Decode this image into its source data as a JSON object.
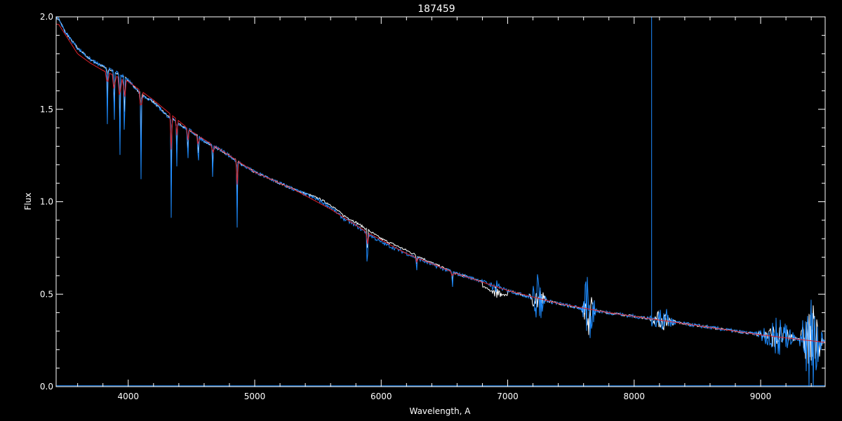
{
  "chart_data": {
    "type": "line",
    "title": "187459",
    "xlabel": "Wavelength, A",
    "ylabel": "Flux",
    "xlim": [
      3430,
      9510
    ],
    "ylim": [
      0.0,
      2.0
    ],
    "x_ticks": [
      4000,
      5000,
      6000,
      7000,
      8000,
      9000
    ],
    "x_tick_labels": [
      "4000",
      "5000",
      "6000",
      "7000",
      "8000",
      "9000"
    ],
    "y_ticks": [
      0.0,
      0.5,
      1.0,
      1.5,
      2.0
    ],
    "y_tick_labels": [
      "0.0",
      "0.5",
      "1.0",
      "1.5",
      "2.0"
    ],
    "grid": false,
    "colors": {
      "background": "#000000",
      "axes": "#ffffff",
      "observed": "#ffffff",
      "fit": "#1e8cff",
      "model": "#e0202a",
      "error": "#1e8cff"
    },
    "series": [
      {
        "x": [
          3450,
          3500,
          3600,
          3700,
          3800,
          3900,
          4000,
          4100,
          4200,
          4300,
          4400,
          4500,
          4600,
          4700,
          4800,
          4900,
          5000,
          5200,
          5400,
          5500,
          5600,
          5700,
          5800,
          6000,
          6200,
          6400,
          6600,
          6800,
          6900,
          7000,
          7200,
          7400,
          7600,
          7800,
          8000,
          8200,
          8400,
          8600,
          8800,
          9000,
          9200,
          9400,
          9500
        ],
        "values": [
          1.99,
          1.92,
          1.83,
          1.77,
          1.73,
          1.7,
          1.66,
          1.58,
          1.54,
          1.47,
          1.42,
          1.38,
          1.33,
          1.29,
          1.25,
          1.2,
          1.16,
          1.1,
          1.04,
          1.01,
          0.97,
          0.91,
          0.87,
          0.78,
          0.72,
          0.66,
          0.61,
          0.57,
          0.54,
          0.52,
          0.48,
          0.45,
          0.42,
          0.4,
          0.38,
          0.36,
          0.34,
          0.32,
          0.3,
          0.28,
          0.27,
          0.25,
          0.24
        ],
        "absorption_lines": [
          {
            "x": 3835,
            "depth": 0.3
          },
          {
            "x": 3889,
            "depth": 0.35
          },
          {
            "x": 3934,
            "depth": 0.5
          },
          {
            "x": 3970,
            "depth": 0.4
          },
          {
            "x": 4101,
            "depth": 0.48
          },
          {
            "x": 4340,
            "depth": 0.55
          },
          {
            "x": 4384,
            "depth": 0.25
          },
          {
            "x": 4471,
            "depth": 0.22
          },
          {
            "x": 4554,
            "depth": 0.2
          },
          {
            "x": 4668,
            "depth": 0.2
          },
          {
            "x": 4861,
            "depth": 0.38
          },
          {
            "x": 5890,
            "depth": 0.25
          },
          {
            "x": 6280,
            "depth": 0.08
          },
          {
            "x": 6563,
            "depth": 0.1
          }
        ],
        "noisy_bands": [
          {
            "x0": 6860,
            "x1": 6960,
            "amp": 0.06
          },
          {
            "x0": 7160,
            "x1": 7320,
            "amp": 0.14
          },
          {
            "x0": 7580,
            "x1": 7700,
            "amp": 0.24
          },
          {
            "x0": 8100,
            "x1": 8340,
            "amp": 0.1
          },
          {
            "x0": 8950,
            "x1": 9300,
            "amp": 0.12
          },
          {
            "x0": 9300,
            "x1": 9500,
            "amp": 0.4
          }
        ],
        "spike": {
          "x": 8138,
          "to": 2.0
        }
      },
      {
        "x": [
          3450,
          3600,
          3700,
          3800,
          4000,
          4200,
          4500,
          4800,
          5000,
          5300,
          5600,
          5900,
          6200,
          6600,
          7000,
          7400,
          7800,
          8200,
          8600,
          9000,
          9500
        ],
        "values": [
          1.96,
          1.8,
          1.75,
          1.71,
          1.65,
          1.55,
          1.38,
          1.25,
          1.16,
          1.07,
          0.96,
          0.83,
          0.72,
          0.61,
          0.52,
          0.45,
          0.4,
          0.36,
          0.32,
          0.28,
          0.24
        ]
      },
      {
        "x": [
          3430,
          5000,
          7000,
          9510
        ],
        "values": [
          0.005,
          0.004,
          0.004,
          0.005
        ]
      }
    ]
  }
}
